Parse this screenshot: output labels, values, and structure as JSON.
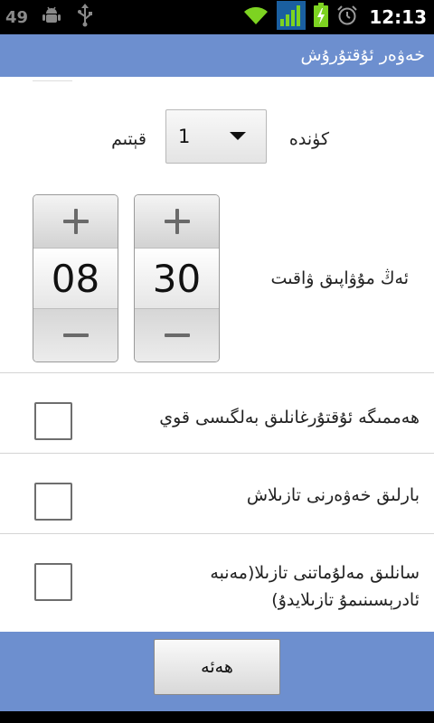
{
  "status_bar": {
    "notification_count": "49",
    "time": "12:13"
  },
  "title_bar": {
    "title": "خەۋەر ئۇقتۇرۇش"
  },
  "week": {
    "label": "كۈندە",
    "value": "1",
    "unit": "قېتىم"
  },
  "time_picker": {
    "hour": "08",
    "minute": "30",
    "label": "ئەڭ مۇۋاپىق ۋاقىت"
  },
  "options": [
    {
      "label": "ھەممىگە ئۇقتۇرغانلىق بەلگىسى قوي",
      "checked": false
    },
    {
      "label": "بارلىق خەۋەرنى تازىلاش",
      "checked": false
    },
    {
      "label": "سانلىق مەلۇماتنى تازىلا(مەنبە ئادرېسىنىمۇ تازىلايدۇ)",
      "checked": false
    }
  ],
  "bottom_bar": {
    "ok_label": "ھەئە"
  },
  "colors": {
    "accent": "#6d8fcf",
    "battery": "#7dd321",
    "signal": "#7dd321"
  }
}
